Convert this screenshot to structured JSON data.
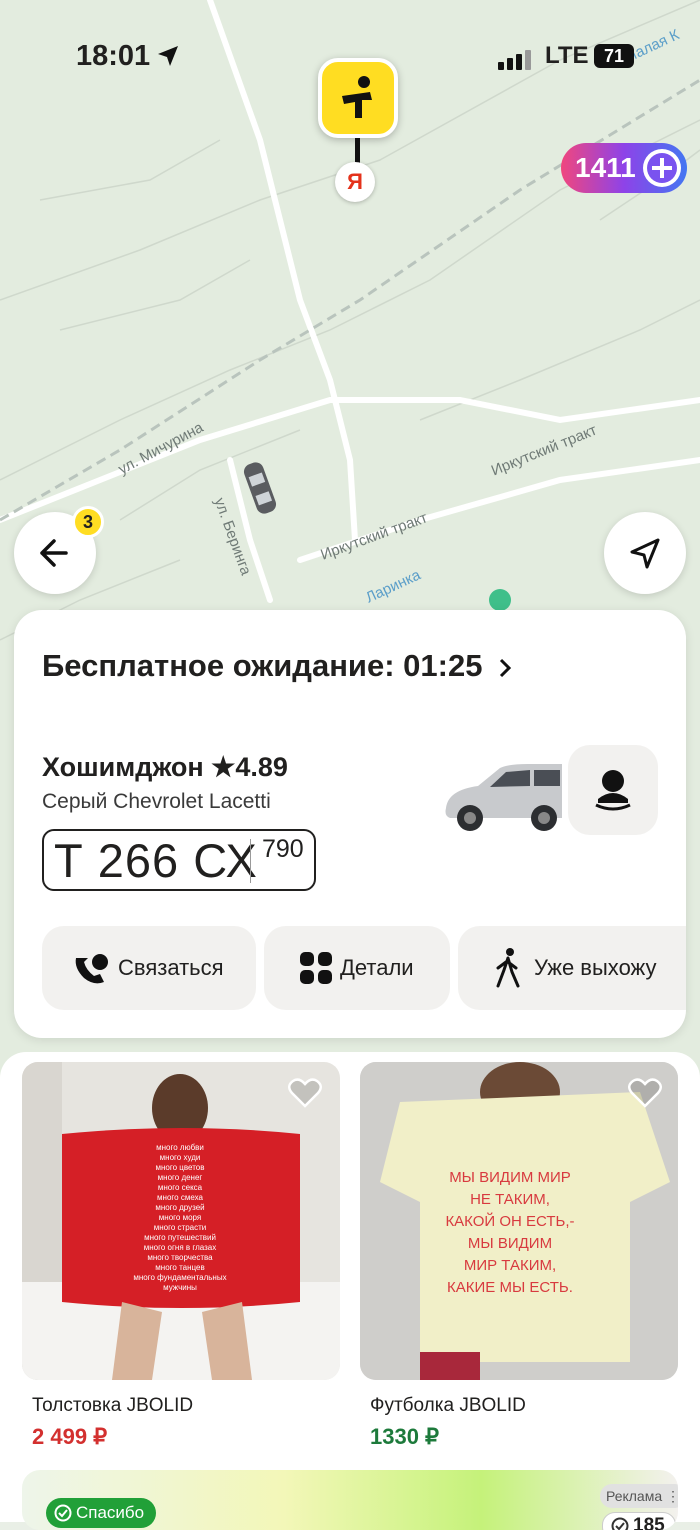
{
  "status_bar": {
    "time": "18:01",
    "network": "LTE",
    "battery": "71"
  },
  "map": {
    "plus_points": "1411",
    "back_badge": "3",
    "streets": [
      "ул. Мичурина",
      "ул. Беринга",
      "Иркутский тракт",
      "Иркутский тракт",
      "Ларинка",
      "Малая К"
    ]
  },
  "ride": {
    "free_wait": "Бесплатное ожидание: 01:25",
    "driver": "Хошимджон ★4.89",
    "car": "Серый Chevrolet Lacetti",
    "plate_number": "Т 266 СХ",
    "plate_region": "790",
    "actions": [
      "Связаться",
      "Детали",
      "Уже выхожу"
    ]
  },
  "products": [
    {
      "name": "Толстовка JBOLID",
      "price": "2 499 ₽",
      "price_color": "#d3302f",
      "print": [
        "много любви",
        "много худи",
        "много цветов",
        "много денег",
        "много секса",
        "много смеха",
        "много друзей",
        "много моря",
        "много страсти",
        "много путешествий",
        "много огня в глазах",
        "много творчества",
        "много танцев",
        "много фундаментальных",
        "мужчины"
      ]
    },
    {
      "name": "Футболка JBOLID",
      "price": "1330 ₽",
      "price_color": "#1d7a3b",
      "print": [
        "МЫ ВИДИМ МИР",
        "НЕ ТАКИМ,",
        "КАКОЙ ОН ЕСТЬ,-",
        "МЫ ВИДИМ",
        "МИР ТАКИМ,",
        "КАКИЕ МЫ ЕСТЬ."
      ]
    }
  ],
  "ad": {
    "brand": "Спасибо",
    "label": "Реклама",
    "points": "185"
  },
  "colors": {
    "accent": "#ffdd22",
    "map": "#e3ecdf"
  }
}
